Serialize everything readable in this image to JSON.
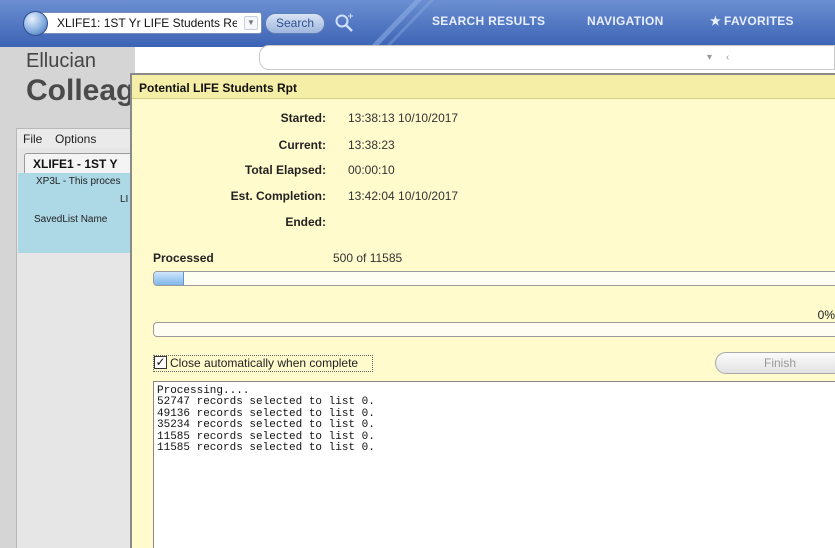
{
  "toolbar": {
    "form_select_value": "XLIFE1: 1ST Yr LIFE Students Re",
    "search_label": "Search",
    "tabs": [
      "SEARCH RESULTS",
      "NAVIGATION",
      "FAVORITES"
    ]
  },
  "app": {
    "brand_line1": "Ellucian",
    "brand_line2": "Colleag",
    "menu": [
      "File",
      "Options"
    ],
    "form_tab": "XLIFE1 - 1ST Y",
    "form_rows": [
      "XP3L - This proces",
      "LI",
      "SavedList Name"
    ]
  },
  "dialog": {
    "title": "Potential LIFE Students Rpt",
    "stats": [
      {
        "label": "Started:",
        "value": "13:38:13  10/10/2017"
      },
      {
        "label": "Current:",
        "value": "13:38:23"
      },
      {
        "label": "Total Elapsed:",
        "value": "00:00:10"
      },
      {
        "label": "Est. Completion:",
        "value": "13:42:04  10/10/2017"
      },
      {
        "label": "Ended:",
        "value": ""
      }
    ],
    "processed_label": "Processed",
    "processed_value": "500  of  11585",
    "progress_fraction": 0.0432,
    "second_progress_fraction": 0,
    "second_percent": "0%",
    "close_auto_label": "Close automatically when complete",
    "close_auto_checked": true,
    "finish_label": "Finish",
    "log_lines": [
      "Processing....",
      "52747 records selected to list 0.",
      "49136 records selected to list 0.",
      "35234 records selected to list 0.",
      "11585 records selected to list 0.",
      "11585 records selected to list 0."
    ]
  }
}
